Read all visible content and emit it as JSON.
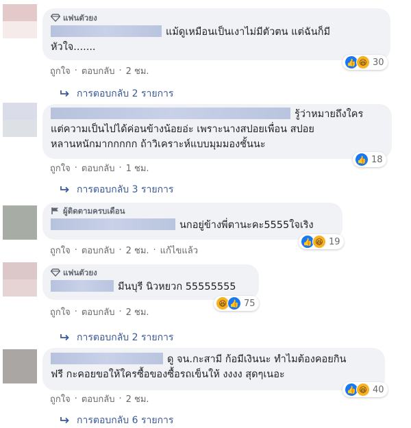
{
  "comments": [
    {
      "badge": "แฟนตัวยง",
      "badge_icon": "diamond-icon",
      "lines": [
        "แม้ดูเหมือนเป็นเงาไม่มีตัวตน แต่ฉันก็มี",
        "หัวใจ......."
      ],
      "reactions": [
        "like",
        "haha"
      ],
      "reaction_count": "30",
      "actions": [
        "ถูกใจ",
        "ตอบกลับ",
        "2 ชม."
      ],
      "replies": "การตอบกลับ 2 รายการ",
      "avatar_colors": [
        "#e3c9c9",
        "#f6ebeb"
      ]
    },
    {
      "badge": "",
      "lines": [
        "รู้ว่าหมายถึงใคร",
        "แต่ความเป็นไปได้ค่อนข้างน้อยอ่ะ เพราะนางสปอยเพื่อน สปอย",
        "หลานหนักมากกกกก ถ้าวิเคราะห์แบบมุมมองชั้นนะ"
      ],
      "reactions": [
        "like"
      ],
      "reaction_count": "18",
      "actions": [
        "ถูกใจ",
        "ตอบกลับ",
        "1 ชม."
      ],
      "replies": "การตอบกลับ 3 รายการ",
      "avatar_colors": [
        "#dadde9",
        "#dde0e4"
      ]
    },
    {
      "badge": "ผู้ติดตามครบเดือน",
      "badge_icon": "flag-icon",
      "lines": [
        "นกอยู่ข้างพี่ตานะคะ5555ใจเริง"
      ],
      "reactions": [
        "like",
        "haha"
      ],
      "reaction_count": "19",
      "actions": [
        "ถูกใจ",
        "ตอบกลับ",
        "2 ชม.",
        "แก้ไขแล้ว"
      ],
      "replies": "",
      "avatar_colors": [
        "#a7aca4",
        "#a7aca4"
      ]
    },
    {
      "badge": "แฟนตัวยง",
      "badge_icon": "diamond-icon",
      "lines": [
        "มีนบุรี นิวหยวก 55555555"
      ],
      "reactions": [
        "haha",
        "like"
      ],
      "reaction_count": "75",
      "actions": [
        "ถูกใจ",
        "ตอบกลับ",
        "2 ชม."
      ],
      "replies": "การตอบกลับ 2 รายการ",
      "avatar_colors": [
        "#dcc8c8",
        "#e6d4d4"
      ]
    },
    {
      "badge": "",
      "lines": [
        "ดู จน.กะสามี ก้อมีเงินนะ ทำไมต้องคอยกิน",
        "ฟรี กะคอยขอให้ใครซื้อของซื้อรถเข็นให้ งงงง สุดๆเนอะ"
      ],
      "reactions": [
        "like",
        "haha"
      ],
      "reaction_count": "40",
      "actions": [
        "ถูกใจ",
        "ตอบกลับ",
        "2 ชม."
      ],
      "replies": "การตอบกลับ 6 รายการ",
      "avatar_colors": [
        "#aaa6a4",
        "#aaa6a4"
      ]
    }
  ],
  "colors": {
    "link": "#385898",
    "meta": "#65676b",
    "bubble": "#f0f2f5",
    "like": "#1877f2",
    "haha": "#f7b125"
  }
}
